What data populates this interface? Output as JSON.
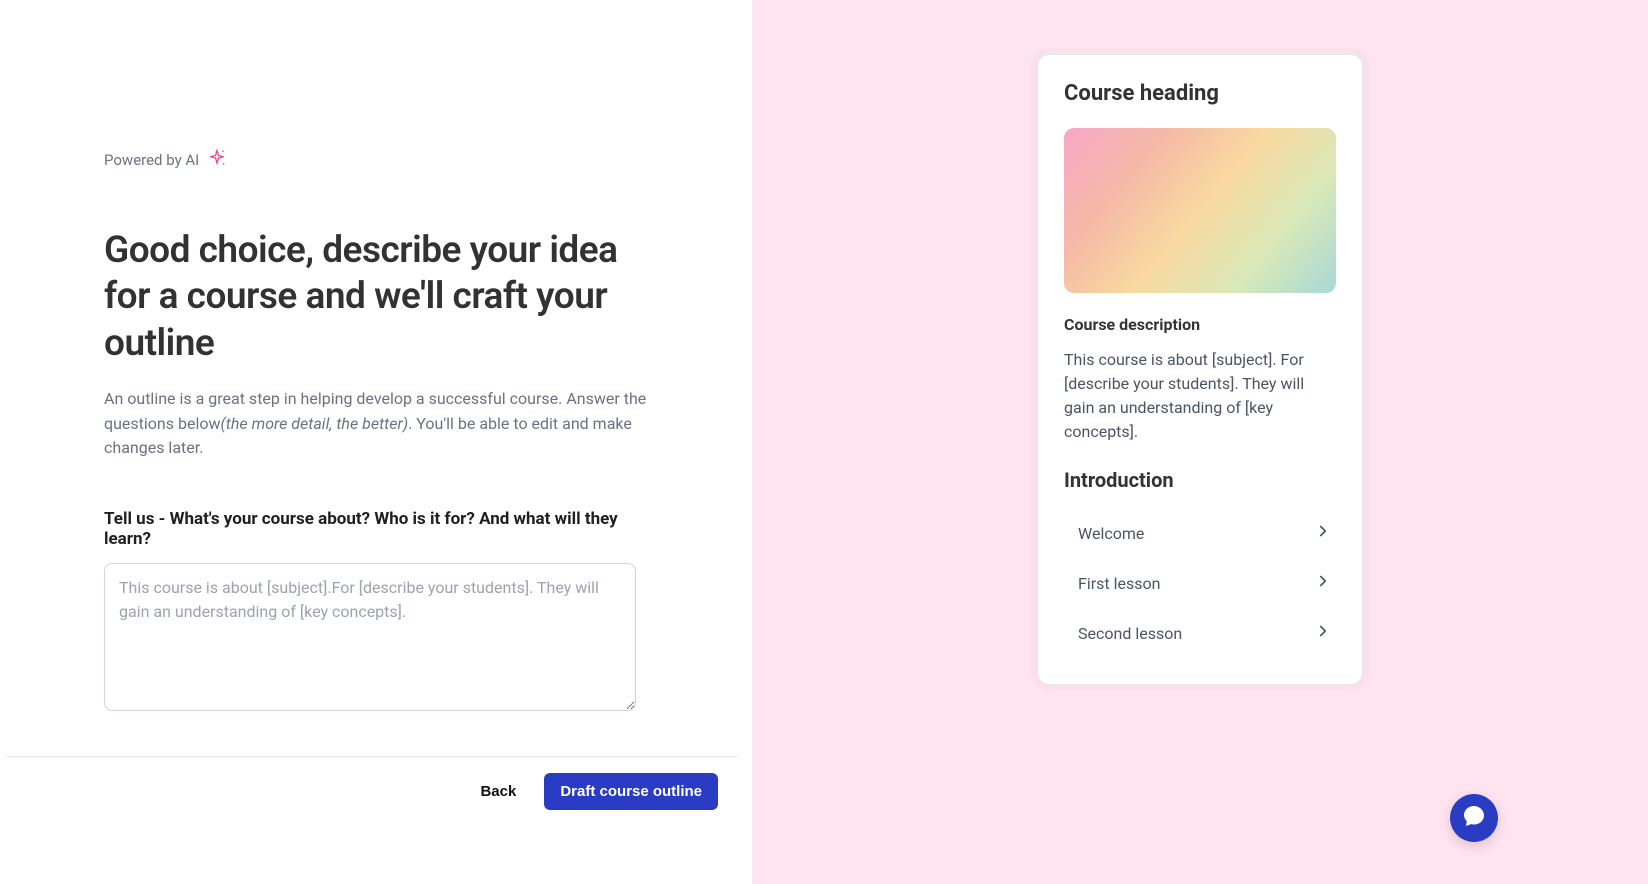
{
  "left": {
    "powered_by": "Powered by AI",
    "headline": "Good choice, describe your idea for a course and we'll craft  your outline",
    "subtext_1": "An outline is a great step in helping develop a successful course.  Answer the questions below",
    "subtext_italic": "(the more detail, the better)",
    "subtext_2": ". You'll be able to edit and make changes later.",
    "prompt_label": "Tell us - What's your course about? Who is it for? And what will they learn?",
    "textarea_placeholder": "This course is about [subject].For [describe your students]. They will gain an understanding of [key concepts].",
    "textarea_value": ""
  },
  "footer": {
    "back_label": "Back",
    "draft_label": "Draft course outline"
  },
  "preview": {
    "heading": "Course heading",
    "description_label": "Course description",
    "description_text": "This course is about [subject]. For [describe your students]. They will gain an understanding of [key concepts].",
    "section_title": "Introduction",
    "lessons": [
      {
        "label": "Welcome"
      },
      {
        "label": "First lesson"
      },
      {
        "label": "Second lesson"
      }
    ]
  },
  "colors": {
    "accent": "#2b3cc4",
    "right_bg": "#ffe4ef"
  }
}
